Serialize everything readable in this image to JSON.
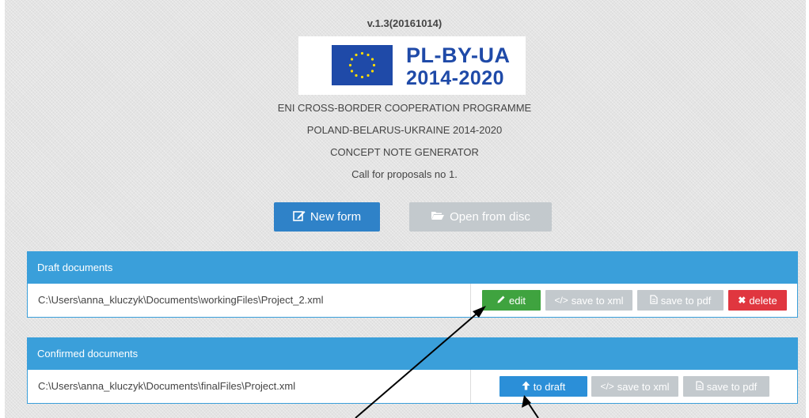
{
  "header": {
    "version": "v.1.3(20161014)",
    "logo": {
      "line1": "PL-BY-UA",
      "line2": "2014-2020"
    },
    "lines": [
      "ENI CROSS-BORDER COOPERATION PROGRAMME",
      "POLAND-BELARUS-UKRAINE 2014-2020",
      "CONCEPT NOTE GENERATOR",
      "Call for proposals no 1."
    ]
  },
  "actions": {
    "new_form": {
      "label": "New form",
      "icon": "edit-icon",
      "color": "#2f82c8"
    },
    "open_from_disc": {
      "label": "Open from disc",
      "icon": "folder-open-icon",
      "color": "#c3c9cd"
    }
  },
  "draft": {
    "title": "Draft documents",
    "rows": [
      {
        "path": "C:\\Users\\anna_kluczyk\\Documents\\workingFiles\\Project_2.xml",
        "buttons": {
          "edit": "edit",
          "save_xml": "save to xml",
          "save_pdf": "save to pdf",
          "delete": "delete"
        }
      }
    ]
  },
  "confirmed": {
    "title": "Confirmed documents",
    "rows": [
      {
        "path": "C:\\Users\\anna_kluczyk\\Documents\\finalFiles\\Project.xml",
        "buttons": {
          "to_draft": "to draft",
          "save_xml": "save to xml",
          "save_pdf": "save to pdf"
        }
      }
    ]
  },
  "colors": {
    "panel_header": "#3a9fda",
    "edit": "#3fa33f",
    "disabled": "#c3c9cd",
    "delete": "#e0363f",
    "to_draft": "#2b8fd8"
  }
}
